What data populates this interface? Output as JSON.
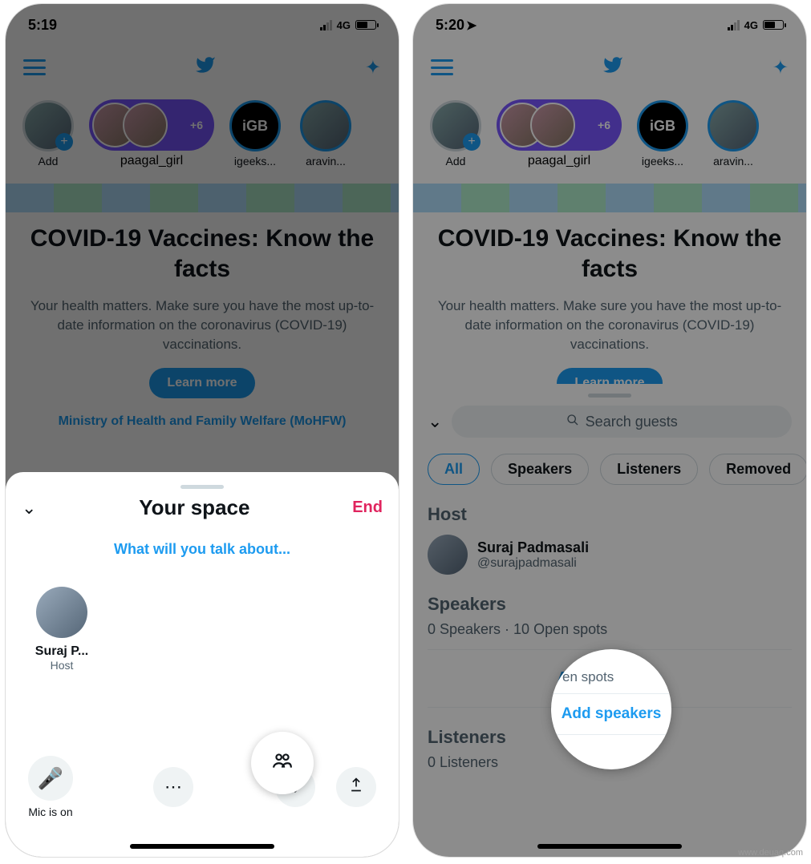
{
  "status": {
    "time_left": "5:19",
    "time_right": "5:20",
    "network": "4G"
  },
  "nav": {
    "bird": "twitter"
  },
  "fleets": {
    "add_label": "Add",
    "pill_label": "paagal_girl",
    "pill_badge": "+6",
    "igb_label": "igeeks...",
    "aravin_label": "aravin..."
  },
  "article": {
    "title": "COVID-19 Vaccines: Know the facts",
    "body": "Your health matters. Make sure you have the most up-to-date information on the coronavirus (COVID-19) vaccinations.",
    "learn": "Learn more",
    "source": "Ministry of Health and Family Welfare (MoHFW)"
  },
  "space": {
    "title": "Your space",
    "end": "End",
    "prompt": "What will you talk about...",
    "host_name": "Suraj P...",
    "host_role": "Host",
    "mic_label": "Mic is on"
  },
  "guests": {
    "search_placeholder": "Search guests",
    "chips": {
      "all": "All",
      "speakers": "Speakers",
      "listeners": "Listeners",
      "removed": "Removed"
    },
    "host_heading": "Host",
    "host_name": "Suraj Padmasali",
    "host_handle": "@surajpadmasali",
    "speakers_heading": "Speakers",
    "speakers_sub": "0 Speakers · 10 Open spots",
    "add_speakers": "Add speakers",
    "listeners_heading": "Listeners",
    "listeners_sub": "0 Listeners"
  },
  "highlight": {
    "sub_fragment": "en spots",
    "add_speakers": "Add speakers"
  }
}
